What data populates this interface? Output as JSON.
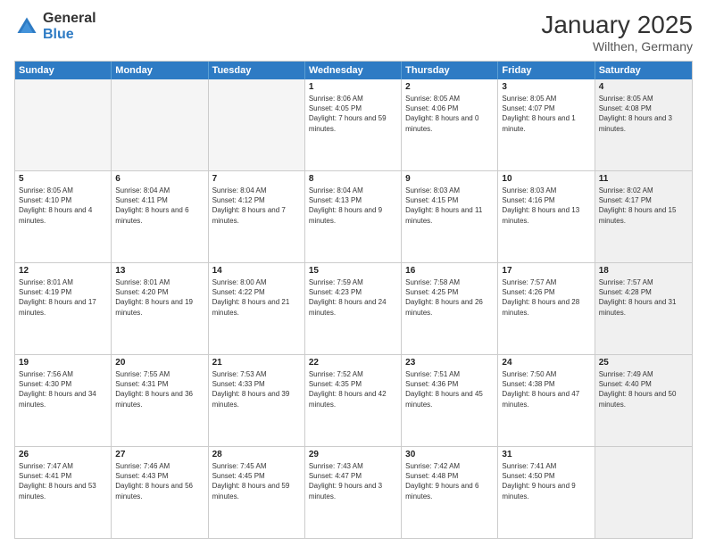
{
  "header": {
    "logo_general": "General",
    "logo_blue": "Blue",
    "title": "January 2025",
    "location": "Wilthen, Germany"
  },
  "days_of_week": [
    "Sunday",
    "Monday",
    "Tuesday",
    "Wednesday",
    "Thursday",
    "Friday",
    "Saturday"
  ],
  "weeks": [
    [
      {
        "day": "",
        "empty": true
      },
      {
        "day": "",
        "empty": true
      },
      {
        "day": "",
        "empty": true
      },
      {
        "day": "1",
        "sunrise": "8:06 AM",
        "sunset": "4:05 PM",
        "daylight": "7 hours and 59 minutes."
      },
      {
        "day": "2",
        "sunrise": "8:05 AM",
        "sunset": "4:06 PM",
        "daylight": "8 hours and 0 minutes."
      },
      {
        "day": "3",
        "sunrise": "8:05 AM",
        "sunset": "4:07 PM",
        "daylight": "8 hours and 1 minute."
      },
      {
        "day": "4",
        "sunrise": "8:05 AM",
        "sunset": "4:08 PM",
        "daylight": "8 hours and 3 minutes.",
        "shaded": true
      }
    ],
    [
      {
        "day": "5",
        "sunrise": "8:05 AM",
        "sunset": "4:10 PM",
        "daylight": "8 hours and 4 minutes."
      },
      {
        "day": "6",
        "sunrise": "8:04 AM",
        "sunset": "4:11 PM",
        "daylight": "8 hours and 6 minutes."
      },
      {
        "day": "7",
        "sunrise": "8:04 AM",
        "sunset": "4:12 PM",
        "daylight": "8 hours and 7 minutes."
      },
      {
        "day": "8",
        "sunrise": "8:04 AM",
        "sunset": "4:13 PM",
        "daylight": "8 hours and 9 minutes."
      },
      {
        "day": "9",
        "sunrise": "8:03 AM",
        "sunset": "4:15 PM",
        "daylight": "8 hours and 11 minutes."
      },
      {
        "day": "10",
        "sunrise": "8:03 AM",
        "sunset": "4:16 PM",
        "daylight": "8 hours and 13 minutes."
      },
      {
        "day": "11",
        "sunrise": "8:02 AM",
        "sunset": "4:17 PM",
        "daylight": "8 hours and 15 minutes.",
        "shaded": true
      }
    ],
    [
      {
        "day": "12",
        "sunrise": "8:01 AM",
        "sunset": "4:19 PM",
        "daylight": "8 hours and 17 minutes."
      },
      {
        "day": "13",
        "sunrise": "8:01 AM",
        "sunset": "4:20 PM",
        "daylight": "8 hours and 19 minutes."
      },
      {
        "day": "14",
        "sunrise": "8:00 AM",
        "sunset": "4:22 PM",
        "daylight": "8 hours and 21 minutes."
      },
      {
        "day": "15",
        "sunrise": "7:59 AM",
        "sunset": "4:23 PM",
        "daylight": "8 hours and 24 minutes."
      },
      {
        "day": "16",
        "sunrise": "7:58 AM",
        "sunset": "4:25 PM",
        "daylight": "8 hours and 26 minutes."
      },
      {
        "day": "17",
        "sunrise": "7:57 AM",
        "sunset": "4:26 PM",
        "daylight": "8 hours and 28 minutes."
      },
      {
        "day": "18",
        "sunrise": "7:57 AM",
        "sunset": "4:28 PM",
        "daylight": "8 hours and 31 minutes.",
        "shaded": true
      }
    ],
    [
      {
        "day": "19",
        "sunrise": "7:56 AM",
        "sunset": "4:30 PM",
        "daylight": "8 hours and 34 minutes."
      },
      {
        "day": "20",
        "sunrise": "7:55 AM",
        "sunset": "4:31 PM",
        "daylight": "8 hours and 36 minutes."
      },
      {
        "day": "21",
        "sunrise": "7:53 AM",
        "sunset": "4:33 PM",
        "daylight": "8 hours and 39 minutes."
      },
      {
        "day": "22",
        "sunrise": "7:52 AM",
        "sunset": "4:35 PM",
        "daylight": "8 hours and 42 minutes."
      },
      {
        "day": "23",
        "sunrise": "7:51 AM",
        "sunset": "4:36 PM",
        "daylight": "8 hours and 45 minutes."
      },
      {
        "day": "24",
        "sunrise": "7:50 AM",
        "sunset": "4:38 PM",
        "daylight": "8 hours and 47 minutes."
      },
      {
        "day": "25",
        "sunrise": "7:49 AM",
        "sunset": "4:40 PM",
        "daylight": "8 hours and 50 minutes.",
        "shaded": true
      }
    ],
    [
      {
        "day": "26",
        "sunrise": "7:47 AM",
        "sunset": "4:41 PM",
        "daylight": "8 hours and 53 minutes."
      },
      {
        "day": "27",
        "sunrise": "7:46 AM",
        "sunset": "4:43 PM",
        "daylight": "8 hours and 56 minutes."
      },
      {
        "day": "28",
        "sunrise": "7:45 AM",
        "sunset": "4:45 PM",
        "daylight": "8 hours and 59 minutes."
      },
      {
        "day": "29",
        "sunrise": "7:43 AM",
        "sunset": "4:47 PM",
        "daylight": "9 hours and 3 minutes."
      },
      {
        "day": "30",
        "sunrise": "7:42 AM",
        "sunset": "4:48 PM",
        "daylight": "9 hours and 6 minutes."
      },
      {
        "day": "31",
        "sunrise": "7:41 AM",
        "sunset": "4:50 PM",
        "daylight": "9 hours and 9 minutes."
      },
      {
        "day": "",
        "empty": true,
        "shaded": true
      }
    ]
  ]
}
